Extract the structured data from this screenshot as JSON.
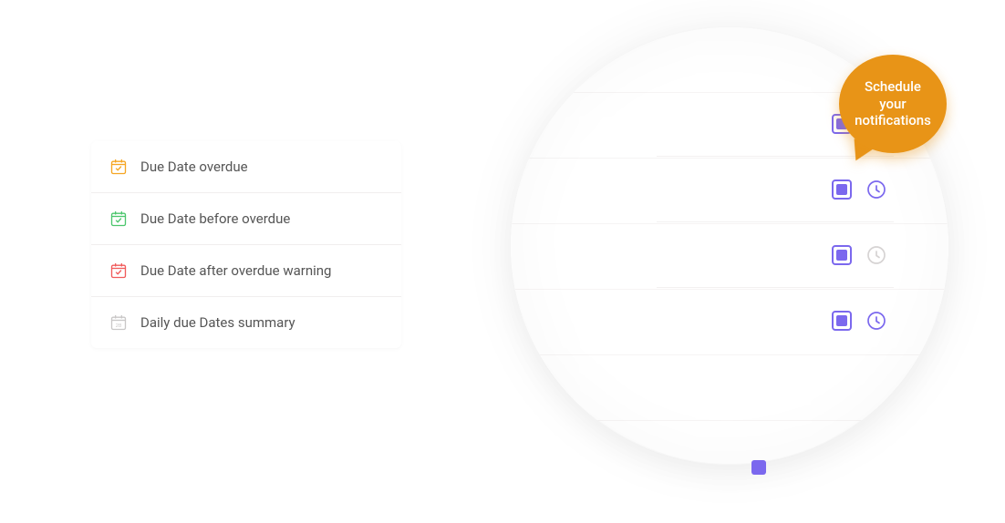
{
  "colors": {
    "accent": "#7b68ee",
    "callout_bg": "#e89417",
    "icon_orange": "#f5a623",
    "icon_green": "#4cc66d",
    "icon_red": "#f15b5b",
    "icon_gray": "#c9c7c7",
    "text": "#555555"
  },
  "rows": [
    {
      "icon": "calendar-check-orange",
      "label": "Due Date overdue",
      "checked": true,
      "clock_active": false
    },
    {
      "icon": "calendar-check-green",
      "label": "Due Date before overdue",
      "checked": true,
      "clock_active": true
    },
    {
      "icon": "calendar-check-red",
      "label": "Due Date after overdue warning",
      "checked": true,
      "clock_active": false
    },
    {
      "icon": "calendar-28-gray",
      "label": "Daily due Dates summary",
      "checked": true,
      "clock_active": true
    }
  ],
  "callout": {
    "line1": "Schedule",
    "line2": "your",
    "line3": "notifications"
  }
}
